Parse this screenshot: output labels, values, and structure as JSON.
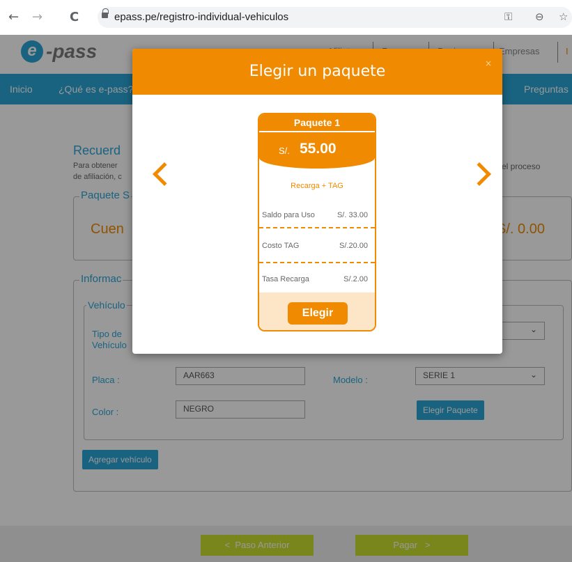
{
  "browser": {
    "back_icon": "←",
    "forward_icon": "→",
    "reload_icon": "C",
    "url": "epass.pe/registro-individual-vehiculos",
    "key_icon": "⚿",
    "zoom_icon": "⊖",
    "star_icon": "☆"
  },
  "header": {
    "logo_letter": "e",
    "logo_text": "-pass",
    "links": [
      "Afiliate",
      "Recargas",
      "Peajes",
      "Empresas",
      "I"
    ]
  },
  "navbar": {
    "items": [
      "Inicio",
      "¿Qué es e-pass?",
      "Preguntas"
    ]
  },
  "page": {
    "recuerda_title": "Recuerd",
    "recuerda_text_line1": "Para obtener",
    "recuerda_text_line2": "de afiliación, c",
    "recuerda_right": "el proceso",
    "paquete_legend": "Paquete S",
    "cuenta_text": "Cuen",
    "amount_text": "S/. 0.00",
    "informacion_legend": "Informac",
    "vehiculo_legend": "Vehículo",
    "tipo_label_1": "Tipo de",
    "tipo_label_2": "Vehículo",
    "placa_label": "Placa :",
    "placa_value": "AAR663",
    "modelo_label": "Modelo :",
    "modelo_value": "SERIE 1",
    "color_label": "Color :",
    "color_value": "NEGRO",
    "elegir_paquete_button": "Elegir Paquete",
    "agregar_button": "Agregar vehículo",
    "paso_anterior_button": "Paso Anterior",
    "pagar_button": "Pagar"
  },
  "modal": {
    "title": "Elegir un paquete",
    "close_icon": "×",
    "card": {
      "header": "Paquete 1",
      "currency": "S/.",
      "price": "55.00",
      "subtitle": "Recarga + TAG",
      "rows": [
        {
          "label": "Saldo para Uso",
          "value": "S/. 33.00"
        },
        {
          "label": "Costo TAG",
          "value": "S/.20.00"
        },
        {
          "label": "Tasa Recarga",
          "value": "S/.2.00"
        }
      ],
      "button": "Elegir"
    }
  },
  "colors": {
    "accent_orange": "#f08a00",
    "brand_blue": "#2aa6d6",
    "green": "#c8e02e"
  }
}
